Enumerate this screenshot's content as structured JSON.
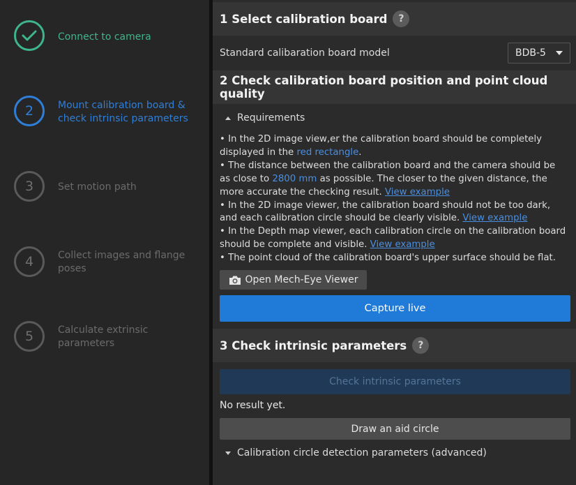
{
  "steps": [
    {
      "number": "",
      "label": "Connect to camera",
      "state": "done"
    },
    {
      "number": "2",
      "label": "Mount calibration board & check intrinsic parameters",
      "state": "active"
    },
    {
      "number": "3",
      "label": "Set motion path",
      "state": "pending"
    },
    {
      "number": "4",
      "label": "Collect images and flange poses",
      "state": "pending"
    },
    {
      "number": "5",
      "label": "Calculate extrinsic parameters",
      "state": "pending"
    }
  ],
  "section1": {
    "title": "1 Select calibration board",
    "help": "?",
    "board_label": "Standard calibaration board model",
    "board_value": "BDB-5"
  },
  "section2": {
    "title": "2 Check calibration board position and point cloud quality",
    "requirements_label": "Requirements",
    "req1_a": "• In the 2D image view,er the calibration board should be completely displayed in the ",
    "req1_hl": "red rectangle",
    "req1_b": ".",
    "req2_a": "• The distance between the calibration board and the camera should be as close to ",
    "req2_hl": "2800 mm",
    "req2_b": " as possible. The closer to the given distance, the more accurate the checking result. ",
    "req2_link": "View example",
    "req3_a": "• In the 2D image viewer, the calibration board should not be too dark, and each calibration circle should be clearly visible. ",
    "req3_link": "View example",
    "req4_a": "• In the Depth map viewer, each calibration circle on the calibration board should be complete and visible. ",
    "req4_link": "View example",
    "req5": "• The point cloud of the calibration board's upper surface should be flat.",
    "open_viewer_label": "Open Mech-Eye Viewer",
    "capture_label": "Capture live"
  },
  "section3": {
    "title": "3 Check intrinsic parameters",
    "help": "?",
    "check_label": "Check intrinsic parameters",
    "result_text": "No result yet.",
    "aid_label": "Draw an aid circle",
    "advanced_label": "Calibration circle detection parameters (advanced)"
  },
  "colors": {
    "done": "#3fb58b",
    "active": "#2f7fd8",
    "primary_button": "#1f7ad8",
    "link": "#4b8fe0"
  }
}
